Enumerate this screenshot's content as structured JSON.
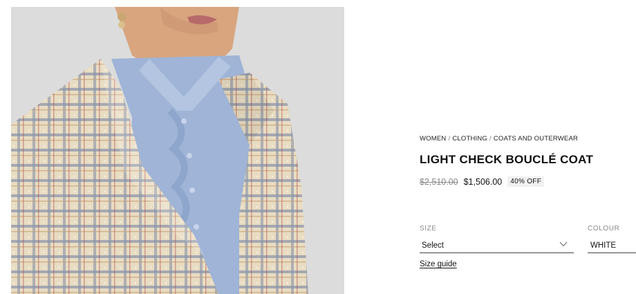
{
  "product": {
    "image_alt": "Model wearing light check bouclé coat over blue ruffled shirt",
    "breadcrumb": [
      "WOMEN",
      "CLOTHING",
      "COATS AND OUTERWEAR"
    ],
    "breadcrumb_separator": "/",
    "title": "LIGHT CHECK BOUCLÉ COAT",
    "price_original": "$2,510.00",
    "price_sale": "$1,506.00",
    "discount_badge": "40% OFF"
  },
  "options": {
    "size_label": "SIZE",
    "size_value": "Select",
    "colour_label": "COLOUR",
    "colour_value": "WHITE",
    "size_guide_link": "Size guide"
  },
  "icons": {
    "size_dropdown": "chevron-down-icon"
  },
  "colors": {
    "image_bg": "#dcdcdc",
    "shirt": "#9fb4d6",
    "tweed": "#e7dcc3"
  }
}
